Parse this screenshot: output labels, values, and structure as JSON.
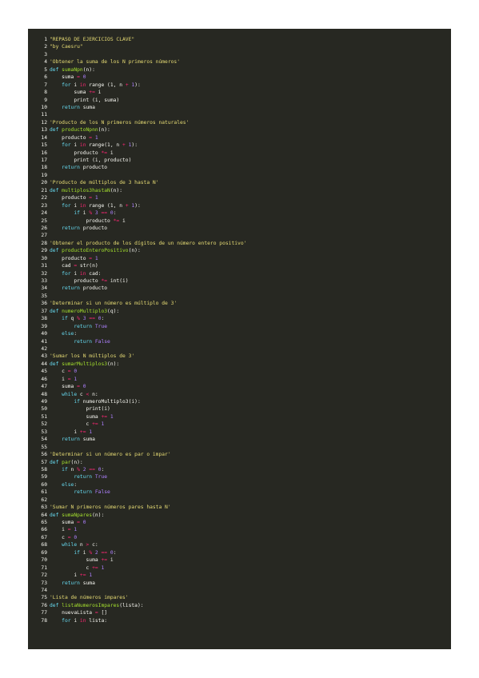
{
  "colors": {
    "background": "#ffffff",
    "editor_bg": "#272822",
    "plain": "#f8f8f2",
    "string": "#e6db74",
    "keyword": "#66d9ef",
    "operator": "#f92672",
    "number": "#ae81ff",
    "function": "#a6e22e"
  },
  "code_lines": [
    {
      "n": "1",
      "tokens": [
        [
          "str",
          "\"REPASO DE EJERCICIOS CLAVE\""
        ]
      ]
    },
    {
      "n": "2",
      "tokens": [
        [
          "str",
          "\"by Caesru\""
        ]
      ]
    },
    {
      "n": "3",
      "tokens": []
    },
    {
      "n": "4",
      "tokens": [
        [
          "str",
          "'Obtener la suma de los N primeros números'"
        ]
      ]
    },
    {
      "n": "5",
      "tokens": [
        [
          "kw",
          "def "
        ],
        [
          "fn",
          "sumaNpn"
        ],
        [
          "plain",
          "(n):"
        ]
      ]
    },
    {
      "n": "6",
      "tokens": [
        [
          "plain",
          "    suma "
        ],
        [
          "op",
          "="
        ],
        [
          "plain",
          " "
        ],
        [
          "num",
          "0"
        ]
      ]
    },
    {
      "n": "7",
      "tokens": [
        [
          "plain",
          "    "
        ],
        [
          "kw",
          "for"
        ],
        [
          "plain",
          " i "
        ],
        [
          "op",
          "in"
        ],
        [
          "plain",
          " range (1, n "
        ],
        [
          "op",
          "+"
        ],
        [
          "plain",
          " "
        ],
        [
          "num",
          "1"
        ],
        [
          "plain",
          "):"
        ]
      ]
    },
    {
      "n": "8",
      "tokens": [
        [
          "plain",
          "        suma "
        ],
        [
          "op",
          "+="
        ],
        [
          "plain",
          " i"
        ]
      ]
    },
    {
      "n": "9",
      "tokens": [
        [
          "plain",
          "        print (i, suma)"
        ]
      ]
    },
    {
      "n": "10",
      "tokens": [
        [
          "plain",
          "    "
        ],
        [
          "kw",
          "return"
        ],
        [
          "plain",
          " suma"
        ]
      ]
    },
    {
      "n": "11",
      "tokens": []
    },
    {
      "n": "12",
      "tokens": [
        [
          "str",
          "'Producto de los N primeros números naturales'"
        ]
      ]
    },
    {
      "n": "13",
      "tokens": [
        [
          "kw",
          "def "
        ],
        [
          "fn",
          "productoNpnn"
        ],
        [
          "plain",
          "(n):"
        ]
      ]
    },
    {
      "n": "14",
      "tokens": [
        [
          "plain",
          "    producto "
        ],
        [
          "op",
          "="
        ],
        [
          "plain",
          " "
        ],
        [
          "num",
          "1"
        ]
      ]
    },
    {
      "n": "15",
      "tokens": [
        [
          "plain",
          "    "
        ],
        [
          "kw",
          "for"
        ],
        [
          "plain",
          " i "
        ],
        [
          "op",
          "in"
        ],
        [
          "plain",
          " range(1, n "
        ],
        [
          "op",
          "+"
        ],
        [
          "plain",
          " "
        ],
        [
          "num",
          "1"
        ],
        [
          "plain",
          "):"
        ]
      ]
    },
    {
      "n": "16",
      "tokens": [
        [
          "plain",
          "        producto "
        ],
        [
          "op",
          "*="
        ],
        [
          "plain",
          " i"
        ]
      ]
    },
    {
      "n": "17",
      "tokens": [
        [
          "plain",
          "        print (i, producto)"
        ]
      ]
    },
    {
      "n": "18",
      "tokens": [
        [
          "plain",
          "    "
        ],
        [
          "kw",
          "return"
        ],
        [
          "plain",
          " producto"
        ]
      ]
    },
    {
      "n": "19",
      "tokens": []
    },
    {
      "n": "20",
      "tokens": [
        [
          "str",
          "'Producto de múltiplos de 3 hasta N'"
        ]
      ]
    },
    {
      "n": "21",
      "tokens": [
        [
          "kw",
          "def "
        ],
        [
          "fn",
          "multiplos3hastaN"
        ],
        [
          "plain",
          "(n):"
        ]
      ]
    },
    {
      "n": "22",
      "tokens": [
        [
          "plain",
          "    producto "
        ],
        [
          "op",
          "="
        ],
        [
          "plain",
          " "
        ],
        [
          "num",
          "1"
        ]
      ]
    },
    {
      "n": "23",
      "tokens": [
        [
          "plain",
          "    "
        ],
        [
          "kw",
          "for"
        ],
        [
          "plain",
          " i "
        ],
        [
          "op",
          "in"
        ],
        [
          "plain",
          " range (1, n "
        ],
        [
          "op",
          "+"
        ],
        [
          "plain",
          " "
        ],
        [
          "num",
          "1"
        ],
        [
          "plain",
          "):"
        ]
      ]
    },
    {
      "n": "24",
      "tokens": [
        [
          "plain",
          "        "
        ],
        [
          "kw",
          "if"
        ],
        [
          "plain",
          " i "
        ],
        [
          "op",
          "%"
        ],
        [
          "plain",
          " "
        ],
        [
          "num",
          "3"
        ],
        [
          "plain",
          " "
        ],
        [
          "op",
          "=="
        ],
        [
          "plain",
          " "
        ],
        [
          "num",
          "0"
        ],
        [
          "plain",
          ":"
        ]
      ]
    },
    {
      "n": "25",
      "tokens": [
        [
          "plain",
          "            producto "
        ],
        [
          "op",
          "*="
        ],
        [
          "plain",
          " i"
        ]
      ]
    },
    {
      "n": "26",
      "tokens": [
        [
          "plain",
          "    "
        ],
        [
          "kw",
          "return"
        ],
        [
          "plain",
          " producto"
        ]
      ]
    },
    {
      "n": "27",
      "tokens": []
    },
    {
      "n": "28",
      "tokens": [
        [
          "str",
          "'Obtener el producto de los dígitos de un número entero positivo'"
        ]
      ]
    },
    {
      "n": "29",
      "tokens": [
        [
          "kw",
          "def "
        ],
        [
          "fn",
          "productoEnteroPositivo"
        ],
        [
          "plain",
          "(n):"
        ]
      ]
    },
    {
      "n": "30",
      "tokens": [
        [
          "plain",
          "    producto "
        ],
        [
          "op",
          "="
        ],
        [
          "plain",
          " "
        ],
        [
          "num",
          "1"
        ]
      ]
    },
    {
      "n": "31",
      "tokens": [
        [
          "plain",
          "    cad "
        ],
        [
          "op",
          "="
        ],
        [
          "plain",
          " str(n)"
        ]
      ]
    },
    {
      "n": "32",
      "tokens": [
        [
          "plain",
          "    "
        ],
        [
          "kw",
          "for"
        ],
        [
          "plain",
          " i "
        ],
        [
          "op",
          "in"
        ],
        [
          "plain",
          " cad:"
        ]
      ]
    },
    {
      "n": "33",
      "tokens": [
        [
          "plain",
          "        producto "
        ],
        [
          "op",
          "*="
        ],
        [
          "plain",
          " int(i)"
        ]
      ]
    },
    {
      "n": "34",
      "tokens": [
        [
          "plain",
          "    "
        ],
        [
          "kw",
          "return"
        ],
        [
          "plain",
          " producto"
        ]
      ]
    },
    {
      "n": "35",
      "tokens": []
    },
    {
      "n": "36",
      "tokens": [
        [
          "str",
          "'Determinar si un número es múltiplo de 3'"
        ]
      ]
    },
    {
      "n": "37",
      "tokens": [
        [
          "kw",
          "def "
        ],
        [
          "fn",
          "numeroMultiplo3"
        ],
        [
          "plain",
          "(q):"
        ]
      ]
    },
    {
      "n": "38",
      "tokens": [
        [
          "plain",
          "    "
        ],
        [
          "kw",
          "if"
        ],
        [
          "plain",
          " q "
        ],
        [
          "op",
          "%"
        ],
        [
          "plain",
          " "
        ],
        [
          "num",
          "3"
        ],
        [
          "plain",
          " "
        ],
        [
          "op",
          "=="
        ],
        [
          "plain",
          " "
        ],
        [
          "num",
          "0"
        ],
        [
          "plain",
          ":"
        ]
      ]
    },
    {
      "n": "39",
      "tokens": [
        [
          "plain",
          "        "
        ],
        [
          "kw",
          "return"
        ],
        [
          "plain",
          " "
        ],
        [
          "num",
          "True"
        ]
      ]
    },
    {
      "n": "40",
      "tokens": [
        [
          "plain",
          "    "
        ],
        [
          "kw",
          "else"
        ],
        [
          "plain",
          ":"
        ]
      ]
    },
    {
      "n": "41",
      "tokens": [
        [
          "plain",
          "        "
        ],
        [
          "kw",
          "return"
        ],
        [
          "plain",
          " "
        ],
        [
          "num",
          "False"
        ]
      ]
    },
    {
      "n": "42",
      "tokens": []
    },
    {
      "n": "43",
      "tokens": [
        [
          "str",
          "'Sumar los N múltiplos de 3'"
        ]
      ]
    },
    {
      "n": "44",
      "tokens": [
        [
          "kw",
          "def "
        ],
        [
          "fn",
          "sumarMultiplos3"
        ],
        [
          "plain",
          "(n):"
        ]
      ]
    },
    {
      "n": "45",
      "tokens": [
        [
          "plain",
          "    c "
        ],
        [
          "op",
          "="
        ],
        [
          "plain",
          " "
        ],
        [
          "num",
          "0"
        ]
      ]
    },
    {
      "n": "46",
      "tokens": [
        [
          "plain",
          "    i "
        ],
        [
          "op",
          "="
        ],
        [
          "plain",
          " "
        ],
        [
          "num",
          "1"
        ]
      ]
    },
    {
      "n": "47",
      "tokens": [
        [
          "plain",
          "    suma "
        ],
        [
          "op",
          "="
        ],
        [
          "plain",
          " "
        ],
        [
          "num",
          "0"
        ]
      ]
    },
    {
      "n": "48",
      "tokens": [
        [
          "plain",
          "    "
        ],
        [
          "kw",
          "while"
        ],
        [
          "plain",
          " c "
        ],
        [
          "op",
          "<"
        ],
        [
          "plain",
          " n:"
        ]
      ]
    },
    {
      "n": "49",
      "tokens": [
        [
          "plain",
          "        "
        ],
        [
          "kw",
          "if"
        ],
        [
          "plain",
          " numeroMultiplo3(i):"
        ]
      ]
    },
    {
      "n": "50",
      "tokens": [
        [
          "plain",
          "            print(i)"
        ]
      ]
    },
    {
      "n": "51",
      "tokens": [
        [
          "plain",
          "            suma "
        ],
        [
          "op",
          "+="
        ],
        [
          "plain",
          " "
        ],
        [
          "num",
          "1"
        ]
      ]
    },
    {
      "n": "52",
      "tokens": [
        [
          "plain",
          "            c "
        ],
        [
          "op",
          "+="
        ],
        [
          "plain",
          " "
        ],
        [
          "num",
          "1"
        ]
      ]
    },
    {
      "n": "53",
      "tokens": [
        [
          "plain",
          "        i "
        ],
        [
          "op",
          "+="
        ],
        [
          "plain",
          " "
        ],
        [
          "num",
          "1"
        ]
      ]
    },
    {
      "n": "54",
      "tokens": [
        [
          "plain",
          "    "
        ],
        [
          "kw",
          "return"
        ],
        [
          "plain",
          " suma"
        ]
      ]
    },
    {
      "n": "55",
      "tokens": []
    },
    {
      "n": "56",
      "tokens": [
        [
          "str",
          "'Determinar si un número es par o impar'"
        ]
      ]
    },
    {
      "n": "57",
      "tokens": [
        [
          "kw",
          "def "
        ],
        [
          "fn",
          "par"
        ],
        [
          "plain",
          "(n):"
        ]
      ]
    },
    {
      "n": "58",
      "tokens": [
        [
          "plain",
          "    "
        ],
        [
          "kw",
          "if"
        ],
        [
          "plain",
          " n "
        ],
        [
          "op",
          "%"
        ],
        [
          "plain",
          " "
        ],
        [
          "num",
          "2"
        ],
        [
          "plain",
          " "
        ],
        [
          "op",
          "=="
        ],
        [
          "plain",
          " "
        ],
        [
          "num",
          "0"
        ],
        [
          "plain",
          ":"
        ]
      ]
    },
    {
      "n": "59",
      "tokens": [
        [
          "plain",
          "        "
        ],
        [
          "kw",
          "return"
        ],
        [
          "plain",
          " "
        ],
        [
          "num",
          "True"
        ]
      ]
    },
    {
      "n": "60",
      "tokens": [
        [
          "plain",
          "    "
        ],
        [
          "kw",
          "else"
        ],
        [
          "plain",
          ":"
        ]
      ]
    },
    {
      "n": "61",
      "tokens": [
        [
          "plain",
          "        "
        ],
        [
          "kw",
          "return"
        ],
        [
          "plain",
          " "
        ],
        [
          "num",
          "False"
        ]
      ]
    },
    {
      "n": "62",
      "tokens": []
    },
    {
      "n": "63",
      "tokens": [
        [
          "str",
          "'Sumar N primeros números pares hasta N'"
        ]
      ]
    },
    {
      "n": "64",
      "tokens": [
        [
          "kw",
          "def "
        ],
        [
          "fn",
          "sumaNpares"
        ],
        [
          "plain",
          "(n):"
        ]
      ]
    },
    {
      "n": "65",
      "tokens": [
        [
          "plain",
          "    suma "
        ],
        [
          "op",
          "="
        ],
        [
          "plain",
          " "
        ],
        [
          "num",
          "0"
        ]
      ]
    },
    {
      "n": "66",
      "tokens": [
        [
          "plain",
          "    i "
        ],
        [
          "op",
          "="
        ],
        [
          "plain",
          " "
        ],
        [
          "num",
          "1"
        ]
      ]
    },
    {
      "n": "67",
      "tokens": [
        [
          "plain",
          "    c "
        ],
        [
          "op",
          "="
        ],
        [
          "plain",
          " "
        ],
        [
          "num",
          "0"
        ]
      ]
    },
    {
      "n": "68",
      "tokens": [
        [
          "plain",
          "    "
        ],
        [
          "kw",
          "while"
        ],
        [
          "plain",
          " n "
        ],
        [
          "op",
          ">"
        ],
        [
          "plain",
          " c:"
        ]
      ]
    },
    {
      "n": "69",
      "tokens": [
        [
          "plain",
          "        "
        ],
        [
          "kw",
          "if"
        ],
        [
          "plain",
          " i "
        ],
        [
          "op",
          "%"
        ],
        [
          "plain",
          " "
        ],
        [
          "num",
          "2"
        ],
        [
          "plain",
          " "
        ],
        [
          "op",
          "=="
        ],
        [
          "plain",
          " "
        ],
        [
          "num",
          "0"
        ],
        [
          "plain",
          ":"
        ]
      ]
    },
    {
      "n": "70",
      "tokens": [
        [
          "plain",
          "            suma "
        ],
        [
          "op",
          "+="
        ],
        [
          "plain",
          " i"
        ]
      ]
    },
    {
      "n": "71",
      "tokens": [
        [
          "plain",
          "            c "
        ],
        [
          "op",
          "+="
        ],
        [
          "plain",
          " "
        ],
        [
          "num",
          "1"
        ]
      ]
    },
    {
      "n": "72",
      "tokens": [
        [
          "plain",
          "        i "
        ],
        [
          "op",
          "+="
        ],
        [
          "plain",
          " "
        ],
        [
          "num",
          "1"
        ]
      ]
    },
    {
      "n": "73",
      "tokens": [
        [
          "plain",
          "    "
        ],
        [
          "kw",
          "return"
        ],
        [
          "plain",
          " suma"
        ]
      ]
    },
    {
      "n": "74",
      "tokens": []
    },
    {
      "n": "75",
      "tokens": [
        [
          "str",
          "'Lista de números impares'"
        ]
      ]
    },
    {
      "n": "76",
      "tokens": [
        [
          "kw",
          "def "
        ],
        [
          "fn",
          "listaNumerosImpares"
        ],
        [
          "plain",
          "(lista):"
        ]
      ]
    },
    {
      "n": "77",
      "tokens": [
        [
          "plain",
          "    nuevaLista "
        ],
        [
          "op",
          "="
        ],
        [
          "plain",
          " []"
        ]
      ]
    },
    {
      "n": "78",
      "tokens": [
        [
          "plain",
          "    "
        ],
        [
          "kw",
          "for"
        ],
        [
          "plain",
          " i "
        ],
        [
          "op",
          "in"
        ],
        [
          "plain",
          " lista:"
        ]
      ]
    }
  ]
}
